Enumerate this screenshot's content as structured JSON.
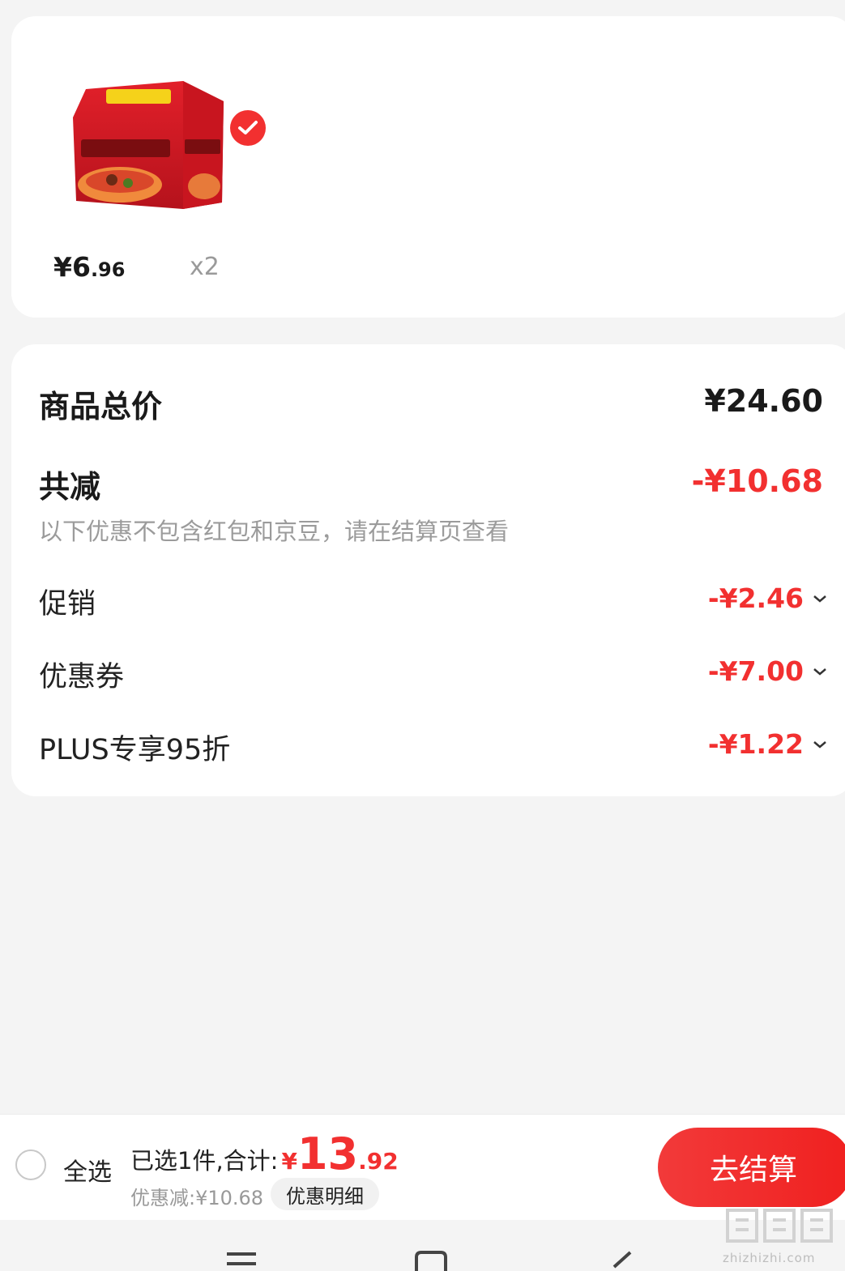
{
  "product": {
    "price_main": "¥6",
    "price_cents": ".96",
    "quantity": "x2",
    "selected": true,
    "image_icon": "instant-noodle-pack"
  },
  "summary": {
    "total_label": "商品总价",
    "total_value": "¥24.60",
    "reduce_label": "共减",
    "reduce_value": "-¥10.68",
    "note": "以下优惠不包含红包和京豆，请在结算页查看",
    "items": [
      {
        "label": "促销",
        "value": "-¥2.46"
      },
      {
        "label": "优惠券",
        "value": "-¥7.00"
      },
      {
        "label": "PLUS专享95折",
        "value": "-¥1.22"
      }
    ]
  },
  "bottom_bar": {
    "select_all": "全选",
    "total_label": "已选1件,合计:",
    "currency": "¥",
    "total_int": "13",
    "total_dec": ".92",
    "discount": "优惠减:¥10.68",
    "detail_button": "优惠明细",
    "checkout_button": "去结算"
  },
  "watermark": {
    "text": "zhizhizhi.com"
  },
  "colors": {
    "accent_red": "#f23030",
    "background": "#f4f4f4"
  }
}
